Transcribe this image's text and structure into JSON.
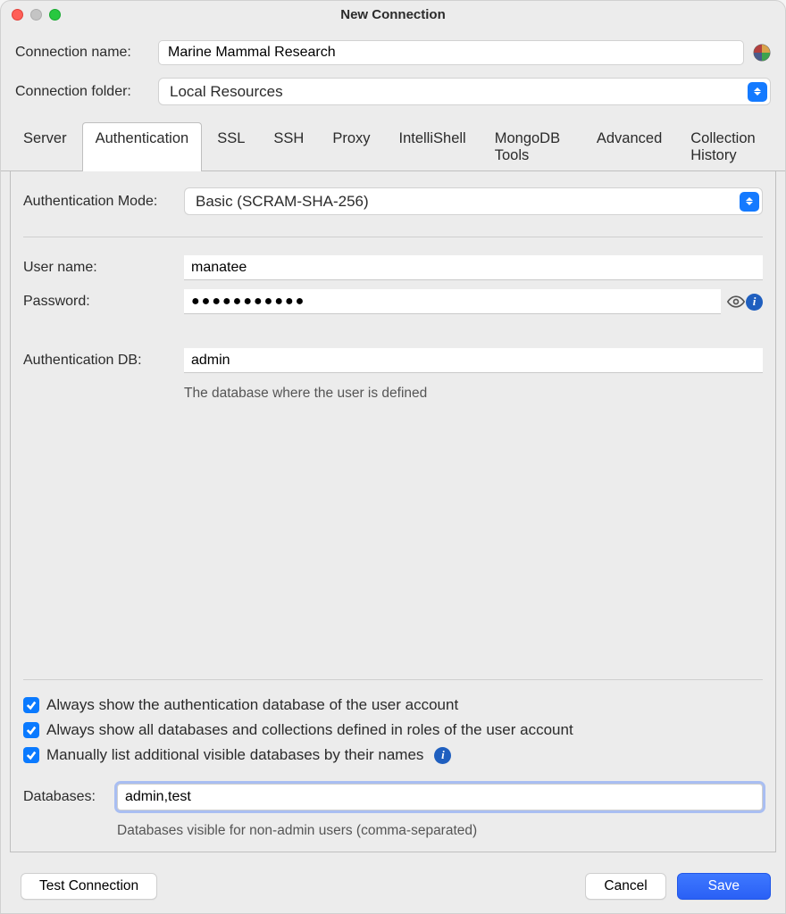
{
  "window": {
    "title": "New Connection"
  },
  "fields": {
    "connection_name_label": "Connection name:",
    "connection_name_value": "Marine Mammal Research",
    "connection_folder_label": "Connection folder:",
    "connection_folder_value": "Local Resources"
  },
  "tabs": [
    {
      "label": "Server",
      "active": false
    },
    {
      "label": "Authentication",
      "active": true
    },
    {
      "label": "SSL",
      "active": false
    },
    {
      "label": "SSH",
      "active": false
    },
    {
      "label": "Proxy",
      "active": false
    },
    {
      "label": "IntelliShell",
      "active": false
    },
    {
      "label": "MongoDB Tools",
      "active": false
    },
    {
      "label": "Advanced",
      "active": false
    },
    {
      "label": "Collection History",
      "active": false
    }
  ],
  "auth": {
    "mode_label": "Authentication Mode:",
    "mode_value": "Basic (SCRAM-SHA-256)",
    "username_label": "User name:",
    "username_value": "manatee",
    "password_label": "Password:",
    "password_masked": "●●●●●●●●●●●",
    "authdb_label": "Authentication DB:",
    "authdb_value": "admin",
    "authdb_help": "The database where the user is defined",
    "check1": "Always show the authentication database of the user account",
    "check2": "Always show all databases and collections defined in roles of the user account",
    "check3": "Manually list additional visible databases by their names",
    "databases_label": "Databases:",
    "databases_value": "admin,test",
    "databases_help": "Databases visible for non-admin users (comma-separated)"
  },
  "buttons": {
    "test": "Test Connection",
    "cancel": "Cancel",
    "save": "Save"
  }
}
